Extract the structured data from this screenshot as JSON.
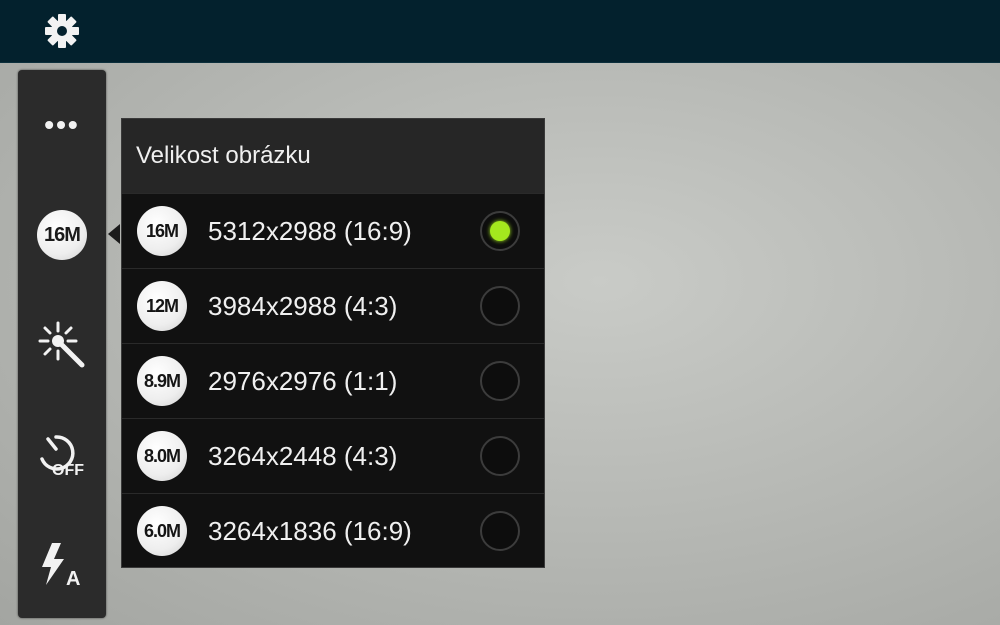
{
  "top_bar": {
    "settings_icon": "gear-icon"
  },
  "sidebar": {
    "items": [
      {
        "name": "more-options",
        "icon": "ellipsis-icon",
        "label": "•••"
      },
      {
        "name": "picture-size",
        "icon": "picture-size-badge",
        "label": "16M"
      },
      {
        "name": "effects",
        "icon": "magic-wand-icon"
      },
      {
        "name": "timer",
        "icon": "timer-off-icon",
        "label": "OFF"
      },
      {
        "name": "flash",
        "icon": "flash-auto-icon",
        "label": "A"
      }
    ]
  },
  "picture_size_panel": {
    "title": "Velikost obrázku",
    "options": [
      {
        "badge": "16M",
        "label": "5312x2988 (16:9)",
        "selected": true
      },
      {
        "badge": "12M",
        "label": "3984x2988 (4:3)",
        "selected": false
      },
      {
        "badge": "8.9M",
        "label": "2976x2976 (1:1)",
        "selected": false
      },
      {
        "badge": "8.0M",
        "label": "3264x2448 (4:3)",
        "selected": false
      },
      {
        "badge": "6.0M",
        "label": "3264x1836 (16:9)",
        "selected": false
      }
    ]
  },
  "colors": {
    "top_bar": "#03212d",
    "selected_radio": "#a4e81e",
    "panel": "#111111"
  }
}
